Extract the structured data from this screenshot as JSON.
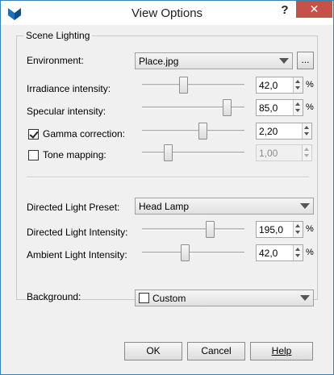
{
  "window": {
    "title": "View Options",
    "help": "?",
    "close": "✕"
  },
  "scene_lighting": {
    "group_label": "Scene Lighting",
    "environment": {
      "label": "Environment:",
      "value": "Place.jpg",
      "browse": "..."
    },
    "irradiance": {
      "label": "Irradiance intensity:",
      "value": "42,0",
      "unit": "%",
      "slider_fraction": 0.4
    },
    "specular": {
      "label": "Specular intensity:",
      "value": "85,0",
      "unit": "%",
      "slider_fraction": 0.83
    },
    "gamma": {
      "label": "Gamma correction:",
      "checked": true,
      "value": "2,20",
      "slider_fraction": 0.59
    },
    "tone": {
      "label": "Tone mapping:",
      "checked": false,
      "value": "1,00",
      "slider_fraction": 0.25
    },
    "preset": {
      "label": "Directed Light Preset:",
      "value": "Head Lamp"
    },
    "directed": {
      "label": "Directed Light Intensity:",
      "value": "195,0",
      "unit": "%",
      "slider_fraction": 0.66
    },
    "ambient": {
      "label": "Ambient Light Intensity:",
      "value": "42,0",
      "unit": "%",
      "slider_fraction": 0.42
    }
  },
  "background": {
    "label": "Background:",
    "value": "Custom"
  },
  "buttons": {
    "ok": "OK",
    "cancel": "Cancel",
    "help": "Help"
  },
  "colors": {
    "close_bg": "#c7504b",
    "accent": "#3c7fb1"
  }
}
